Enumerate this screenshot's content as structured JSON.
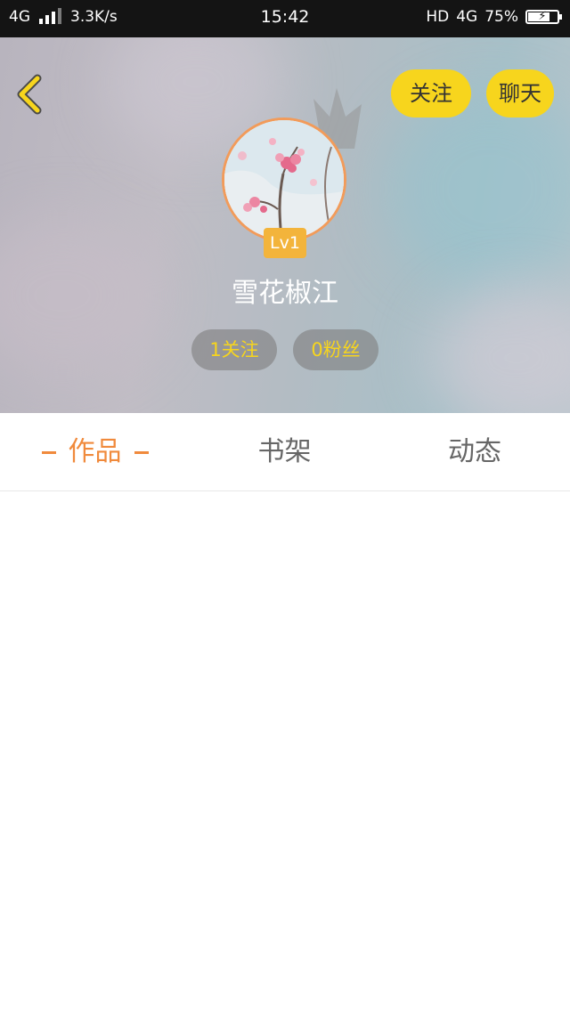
{
  "status_bar": {
    "network": "4G",
    "speed": "3.3K/s",
    "time": "15:42",
    "hd_label": "HD",
    "network_right": "4G",
    "battery": "75%",
    "battery_level": 0.75
  },
  "header": {
    "follow_button": "关注",
    "chat_button": "聊天",
    "level": "Lv1",
    "username": "雪花椒江",
    "stats": {
      "following": "1关注",
      "fans": "0粉丝"
    }
  },
  "tabs": [
    {
      "label": "作品",
      "active": true
    },
    {
      "label": "书架",
      "active": false
    },
    {
      "label": "动态",
      "active": false
    }
  ],
  "colors": {
    "accent_yellow": "#f7d51d",
    "active_tab": "#f08a3c",
    "level_badge": "#f3b43b",
    "avatar_border": "#f29b5a"
  }
}
